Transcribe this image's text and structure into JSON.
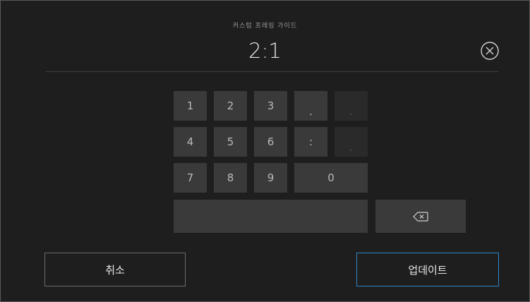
{
  "header": {
    "title": "커스텀 프레임 가이드",
    "value": "2:1"
  },
  "keypad": {
    "k1": "1",
    "k2": "2",
    "k3": "3",
    "kdot": ".",
    "kdot2": ".",
    "k4": "4",
    "k5": "5",
    "k6": "6",
    "kcolon": ":",
    "kdot3": ".",
    "k7": "7",
    "k8": "8",
    "k9": "9",
    "k0": "0"
  },
  "actions": {
    "cancel_label": "취소",
    "update_label": "업데이트"
  },
  "colors": {
    "background": "#1e1e1e",
    "key": "#3a3a3a",
    "accent": "#2f86c8"
  },
  "icons": {
    "close": "close-circle-icon",
    "backspace": "backspace-icon"
  }
}
